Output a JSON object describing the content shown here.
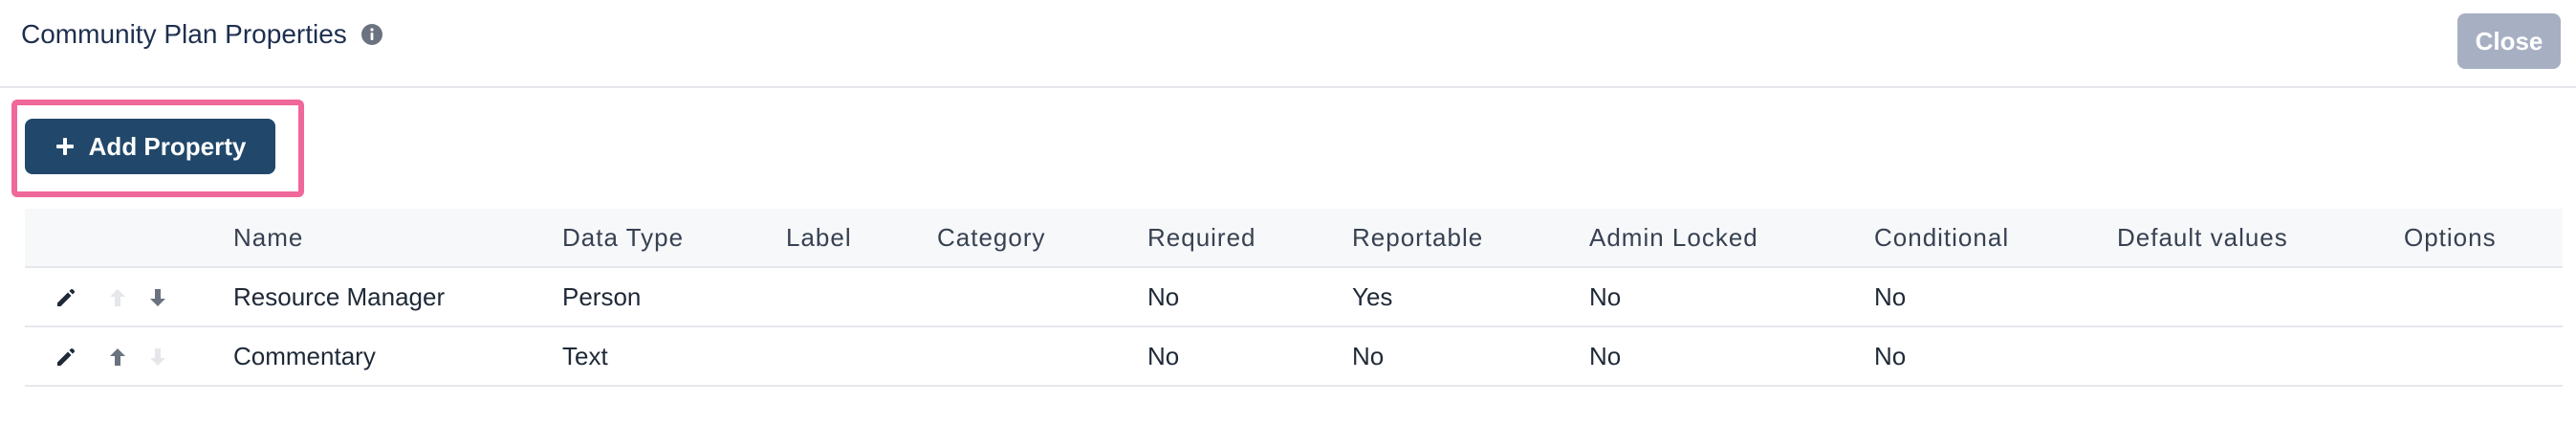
{
  "dialog": {
    "title": "Community Plan Properties",
    "close_label": "Close",
    "info_icon": "info-circle-icon"
  },
  "toolbar": {
    "add_label": "Add Property",
    "add_icon": "plus-icon"
  },
  "table": {
    "columns": [
      "",
      "Name",
      "Data Type",
      "Label",
      "Category",
      "Required",
      "Reportable",
      "Admin Locked",
      "Conditional",
      "Default values",
      "Options"
    ],
    "rows": [
      {
        "name": "Resource Manager",
        "data_type": "Person",
        "label": "",
        "category": "",
        "required": "No",
        "reportable": "Yes",
        "admin_locked": "No",
        "conditional": "No",
        "default_values": "",
        "options": "",
        "move_up_enabled": false,
        "move_down_enabled": true
      },
      {
        "name": "Commentary",
        "data_type": "Text",
        "label": "",
        "category": "",
        "required": "No",
        "reportable": "No",
        "admin_locked": "No",
        "conditional": "No",
        "default_values": "",
        "options": "",
        "move_up_enabled": true,
        "move_down_enabled": false
      }
    ]
  },
  "colors": {
    "primary": "#21486b",
    "highlight": "#f0679a",
    "close_disabled": "#a7afc3",
    "icon_enabled": "#6b7280",
    "icon_disabled": "#e5e7eb",
    "title_text": "#1e2f4f"
  }
}
